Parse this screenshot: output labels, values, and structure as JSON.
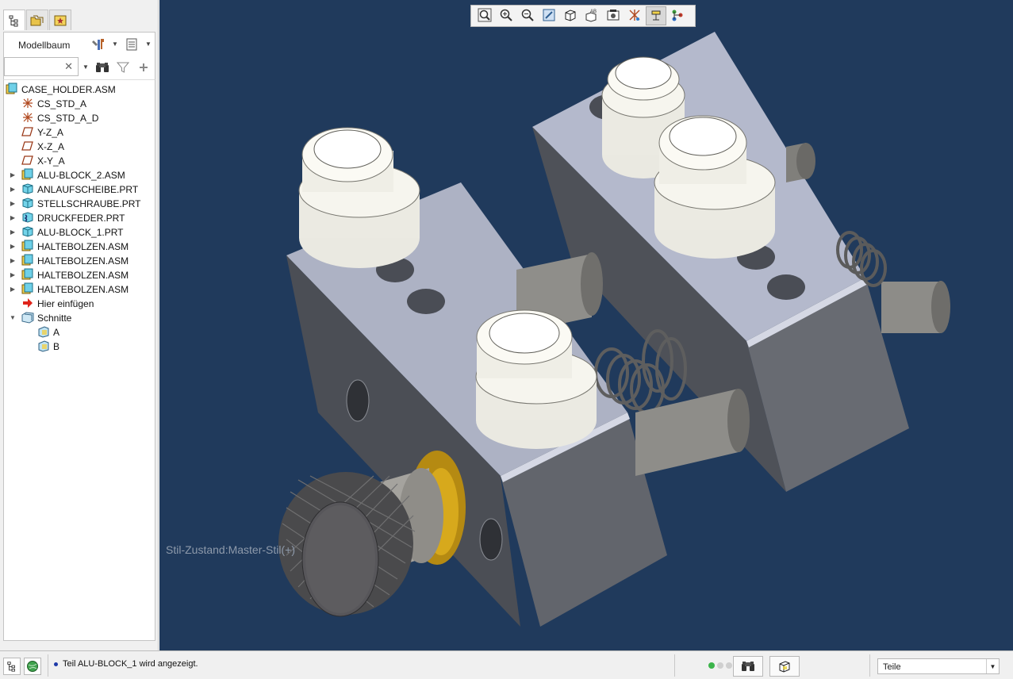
{
  "left_panel": {
    "tabs": [
      {
        "icon": "model-tree-icon"
      },
      {
        "icon": "folder-browser-icon"
      },
      {
        "icon": "favorites-icon"
      }
    ],
    "tree_title": "Modellbaum",
    "search": {
      "value": "",
      "placeholder": ""
    },
    "tree": [
      {
        "label": "CASE_HOLDER.ASM",
        "icon": "assembly-icon",
        "level": 0,
        "expander": ""
      },
      {
        "label": "CS_STD_A",
        "icon": "csys-icon",
        "level": 1,
        "expander": ""
      },
      {
        "label": "CS_STD_A_D",
        "icon": "csys-icon",
        "level": 1,
        "expander": ""
      },
      {
        "label": "Y-Z_A",
        "icon": "datum-plane-icon",
        "level": 1,
        "expander": ""
      },
      {
        "label": "X-Z_A",
        "icon": "datum-plane-icon",
        "level": 1,
        "expander": ""
      },
      {
        "label": "X-Y_A",
        "icon": "datum-plane-icon",
        "level": 1,
        "expander": ""
      },
      {
        "label": "ALU-BLOCK_2.ASM",
        "icon": "assembly-icon",
        "level": 1,
        "expander": "▶"
      },
      {
        "label": "ANLAUFSCHEIBE.PRT",
        "icon": "part-icon",
        "level": 1,
        "expander": "▶"
      },
      {
        "label": "STELLSCHRAUBE.PRT",
        "icon": "part-icon",
        "level": 1,
        "expander": "▶"
      },
      {
        "label": "DRUCKFEDER.PRT",
        "icon": "part-flex-icon",
        "level": 1,
        "expander": "▶"
      },
      {
        "label": "ALU-BLOCK_1.PRT",
        "icon": "part-icon",
        "level": 1,
        "expander": "▶"
      },
      {
        "label": "HALTEBOLZEN.ASM",
        "icon": "assembly-icon",
        "level": 1,
        "expander": "▶"
      },
      {
        "label": "HALTEBOLZEN.ASM",
        "icon": "assembly-icon",
        "level": 1,
        "expander": "▶"
      },
      {
        "label": "HALTEBOLZEN.ASM",
        "icon": "assembly-icon",
        "level": 1,
        "expander": "▶"
      },
      {
        "label": "HALTEBOLZEN.ASM",
        "icon": "assembly-icon",
        "level": 1,
        "expander": "▶"
      },
      {
        "label": "Hier einfügen",
        "icon": "insert-here-arrow-icon",
        "level": 1,
        "expander": ""
      },
      {
        "label": "Schnitte",
        "icon": "sections-folder-icon",
        "level": 1,
        "expander": "▼"
      },
      {
        "label": "A",
        "icon": "section-icon",
        "level": 2,
        "expander": ""
      },
      {
        "label": "B",
        "icon": "section-icon",
        "level": 2,
        "expander": ""
      }
    ]
  },
  "viewport": {
    "background_color": "#203a5c",
    "style_state": "Stil-Zustand:Master-Stil(+)",
    "toolbar": [
      {
        "icon": "refit-icon"
      },
      {
        "icon": "zoom-in-icon"
      },
      {
        "icon": "zoom-out-icon"
      },
      {
        "icon": "repaint-icon"
      },
      {
        "icon": "display-style-icon"
      },
      {
        "icon": "saved-orientations-icon"
      },
      {
        "icon": "view-manager-icon"
      },
      {
        "icon": "datum-display-filters-icon"
      },
      {
        "icon": "annotation-display-icon"
      },
      {
        "icon": "spin-center-icon"
      }
    ]
  },
  "status_bar": {
    "message": "Teil ALU-BLOCK_1 wird angezeigt.",
    "filter_value": "Teile"
  }
}
